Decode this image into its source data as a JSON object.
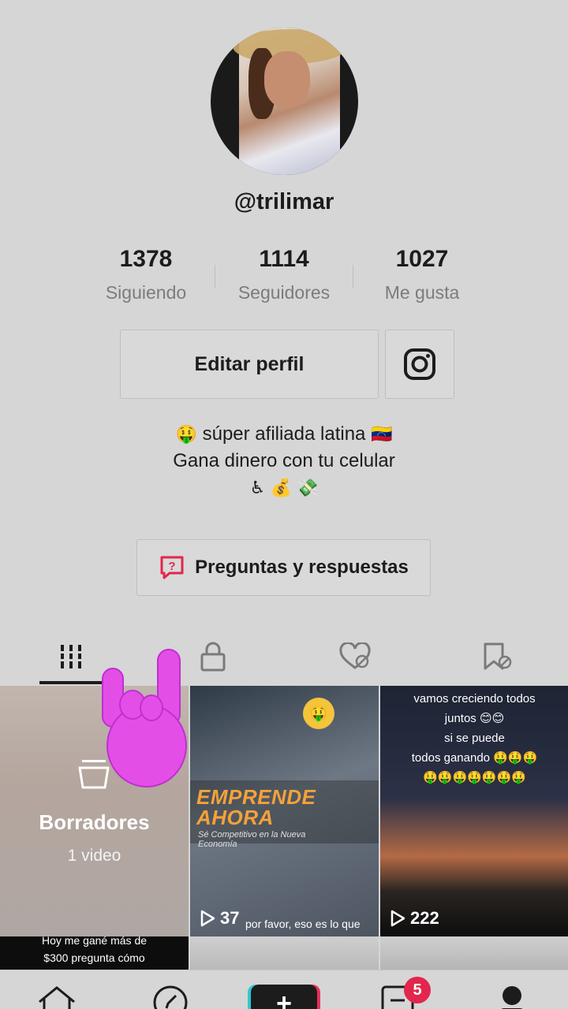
{
  "profile": {
    "handle": "@trilimar",
    "stats": [
      {
        "value": "1378",
        "label": "Siguiendo"
      },
      {
        "value": "1114",
        "label": "Seguidores"
      },
      {
        "value": "1027",
        "label": "Me gusta"
      }
    ],
    "edit_button": "Editar perfil",
    "instagram_icon": "instagram-icon",
    "bio": {
      "line1_emoji_start": "🤑",
      "line1_text": "súper afiliada latina",
      "line1_emoji_end": "🇻🇪",
      "line2": "Gana dinero con tu celular",
      "line3": "♿ 💰 💸"
    },
    "qa_button": "Preguntas y respuestas"
  },
  "tabs": [
    {
      "icon": "grid-icon",
      "active": true
    },
    {
      "icon": "lock-icon",
      "active": false
    },
    {
      "icon": "heart-hidden-icon",
      "active": false
    },
    {
      "icon": "bookmark-hidden-icon",
      "active": false
    }
  ],
  "videos": [
    {
      "type": "drafts",
      "title": "Borradores",
      "subtitle": "1 video"
    },
    {
      "type": "video",
      "headline": "EMPRENDE AHORA",
      "subheadline": "Sé Competitivo en la Nueva Economía",
      "bottom_text": "por favor, eso es lo que",
      "coin": "🤑",
      "views": "37"
    },
    {
      "type": "video",
      "caption": [
        "vamos creciendo todos",
        "juntos 😊😊",
        "si se puede",
        "todos ganando 🤑🤑🤑",
        "🤑🤑🤑🤑🤑🤑🤑"
      ],
      "views": "222"
    }
  ],
  "row2": {
    "first_caption": [
      "Hoy me gané más de",
      "$300 pregunta cómo"
    ]
  },
  "sticker": "rock-hand-sticker",
  "nav": {
    "inbox_badge": "5",
    "plus_label": "+"
  },
  "colors": {
    "background": "#d6d6d6",
    "accent_red": "#e2264d",
    "accent_cyan": "#30c8d0",
    "emprende_orange": "#f4a23a",
    "sticker_magenta": "#e34fe6"
  }
}
